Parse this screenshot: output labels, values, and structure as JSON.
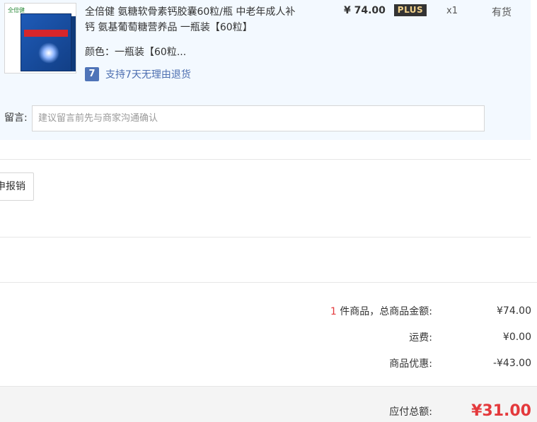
{
  "product": {
    "logo_text": "全倍健",
    "title": "全倍健 氨糖软骨素钙胶囊60粒/瓶 中老年成人补钙 氨基葡萄糖营养品 一瓶装【60粒】",
    "price": "¥ 74.00",
    "plus_badge": "PLUS",
    "quantity": "x1",
    "stock": "有货",
    "color_label": "颜色：",
    "color_value": "一瓶装【60粒...",
    "return_icon_text": "7",
    "return_policy": "支持7天无理由退货"
  },
  "memo": {
    "label": "留言:",
    "placeholder": "建议留言前先与商家沟通确认"
  },
  "reimburse_button": "申报销",
  "summary": {
    "count": "1",
    "items_label": " 件商品，总商品金额:",
    "items_amount": "¥74.00",
    "shipping_label": "运费:",
    "shipping_amount": "¥0.00",
    "discount_label": "商品优惠:",
    "discount_amount": "-¥43.00",
    "total_label": "应付总额:",
    "total_amount": "¥31.00"
  },
  "colors": {
    "accent_red": "#e4393c",
    "panel_bg": "#f3f9ff",
    "link_blue": "#4d6fb0",
    "plus_gold": "#f2d28a"
  }
}
